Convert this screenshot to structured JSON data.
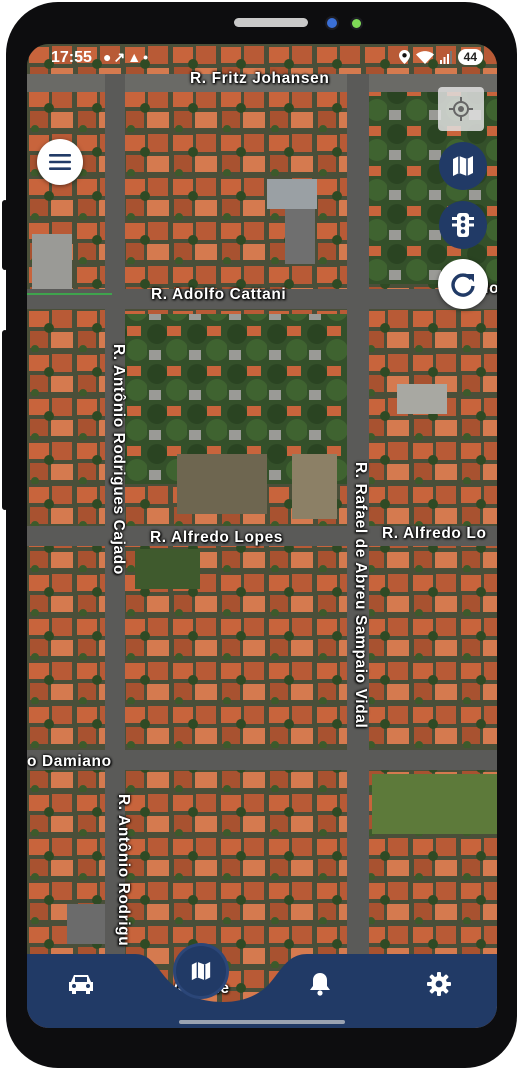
{
  "status_bar": {
    "time": "17:55",
    "battery": "44",
    "notification_icons": [
      "chat-bubble-icon",
      "missed-call-icon",
      "mute-icon",
      "dot-icon"
    ],
    "system_icons": [
      "location-pin-icon",
      "wifi-icon",
      "signal-icon",
      "battery-icon"
    ]
  },
  "map": {
    "type": "satellite",
    "street_labels": {
      "fritz": "R. Fritz Johansen",
      "cattani": "R. Adolfo Cattani",
      "cattani_cut": "do",
      "antonio1": "R. Antônio Rodrigues Cajado",
      "alfredo1": "R. Alfredo Lopes",
      "alfredo2": "R. Alfredo Lo",
      "rafael": "R. Rafael de Abreu Sampaio Vidal",
      "damiano": "o Damiano",
      "antonio2": "R. Antônio Rodrigu",
      "bottom": "R. Alfrede"
    }
  },
  "controls": {
    "menu": "hamburger-menu-icon",
    "my_location": "crosshair-location-icon",
    "map_layers": "map-icon",
    "traffic": "traffic-light-icon",
    "refresh": "refresh-icon"
  },
  "bottom_nav": {
    "items": [
      "car-icon",
      "map-icon",
      "bell-icon",
      "gear-icon"
    ],
    "active": "map-icon"
  },
  "colors": {
    "nav_bg": "#213a66",
    "fab_dark": "#213a66",
    "fab_light": "#ffffff",
    "road": "#5a5a58",
    "roof_orange": "#c8643c"
  }
}
